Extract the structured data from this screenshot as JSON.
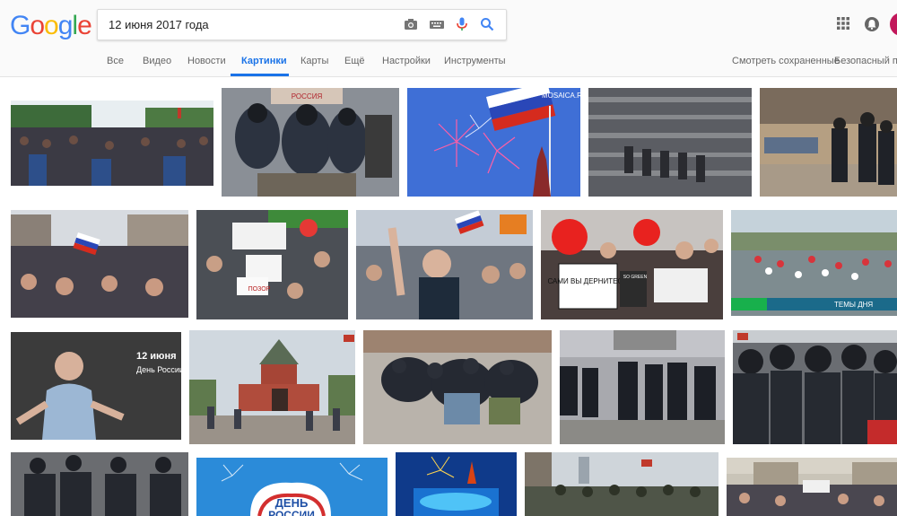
{
  "logo": "Google",
  "search": {
    "query": "12 июня 2017 года"
  },
  "tabs": [
    {
      "label": "Все"
    },
    {
      "label": "Видео"
    },
    {
      "label": "Новости"
    },
    {
      "label": "Картинки"
    },
    {
      "label": "Карты"
    },
    {
      "label": "Ещё"
    },
    {
      "label": "Настройки"
    },
    {
      "label": "Инструменты"
    }
  ],
  "right_links": {
    "saved": "Смотреть сохраненные",
    "safe": "Безопасный поиск"
  },
  "image_texts": {
    "mosaica": "MOSAICA.RU",
    "navalny_date": "12 июня",
    "navalny_sub": "День России",
    "poster_1": "САМИ ВЫ ДЕРНИТЕСЬ",
    "temy_dnya": "ТЕМЫ ДНЯ",
    "den": "ДЕНЬ",
    "rossii": "РОССИИ",
    "russia_banner": "РОССИЯ",
    "poster_2": "ПОЗОР",
    "so_green": "SO GREEN"
  },
  "colors": {
    "accent": "#1a73e8",
    "google_blue": "#4285f4",
    "google_red": "#ea4335",
    "google_yellow": "#fbbc05",
    "google_green": "#34a853"
  }
}
